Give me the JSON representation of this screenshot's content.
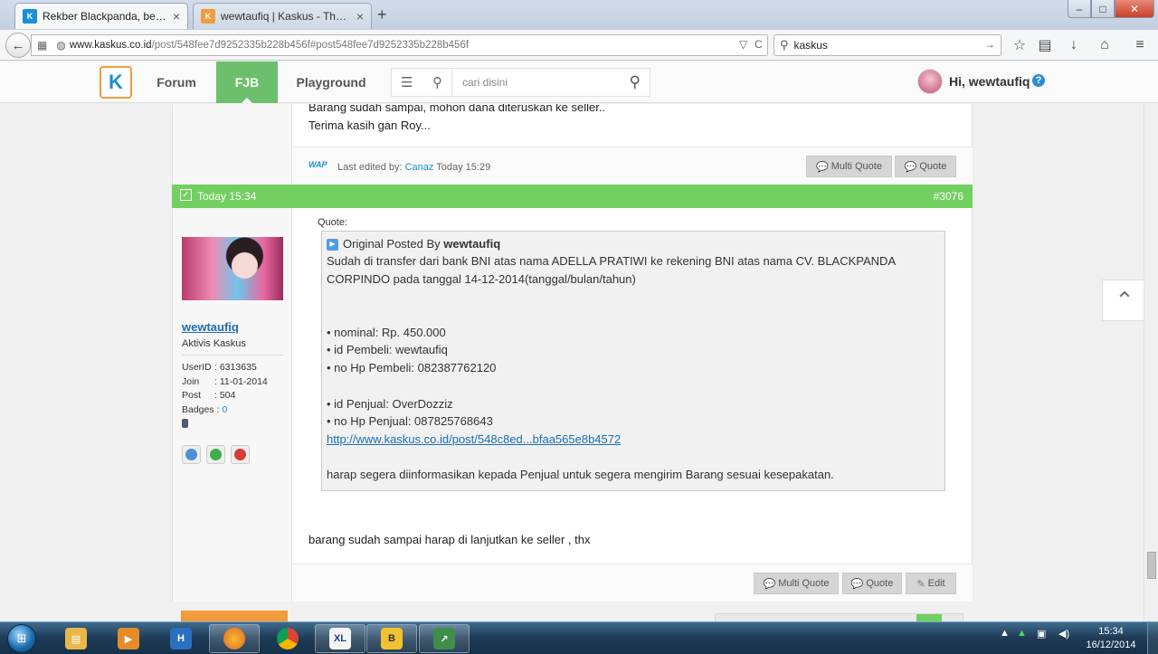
{
  "browser": {
    "tabs": [
      {
        "title": "Rekber Blackpanda, belanj...",
        "active": true
      },
      {
        "title": "wewtaufiq | Kaskus - The L...",
        "active": false
      }
    ],
    "url_host": "www.kaskus.co.id",
    "url_path": "/post/548fee7d9252335b228b456f#post548fee7d9252335b228b456f",
    "search_value": "kaskus",
    "window_controls": {
      "minimize": "–",
      "maximize": "□",
      "close": "✕"
    },
    "new_tab": "+"
  },
  "site": {
    "logo_glyph": "K",
    "nav": {
      "forum": "Forum",
      "fjb": "FJB",
      "playground": "Playground"
    },
    "search_placeholder": "cari disini",
    "greeting": "Hi, wewtaufiq",
    "help": "?"
  },
  "prev_post": {
    "lines": [
      "Barang sudah sampai, mohon dana diteruskan ke seller..",
      "Terima kasih gan Roy..."
    ],
    "edited_prefix": "Last edited by: ",
    "edited_user": "Canaz",
    "edited_time": " Today 15:29",
    "wap_label": "WAP",
    "buttons": {
      "multi_quote": "Multi Quote",
      "quote": "Quote"
    }
  },
  "post": {
    "date": "Today 15:34",
    "number": "#3076",
    "user": {
      "name": "wewtaufiq",
      "rank": "Aktivis Kaskus",
      "userid_label": "UserID",
      "userid": ": 6313635",
      "join_label": "Join",
      "join": ": 11-01-2014",
      "post_label": "Post",
      "post_count": ": 504",
      "badges_label": "Badges",
      "badges_sep": " : ",
      "badges": "0"
    },
    "quote_label": "Quote:",
    "quote": {
      "header_prefix": "Original Posted By ",
      "author": "wewtaufiq",
      "lines": [
        "Sudah di transfer dari bank BNI atas nama ADELLA PRATIWI ke rekening BNI atas nama CV. BLACKPANDA",
        "CORPINDO pada tanggal 14-12-2014(tanggal/bulan/tahun)",
        "",
        "",
        "• nominal: Rp. 450.000",
        "• id Pembeli: wewtaufiq",
        "• no Hp Pembeli: 082387762120",
        "",
        "• id Penjual: OverDozziz",
        "• no Hp Penjual: 087825768643"
      ],
      "link": "http://www.kaskus.co.id/post/548c8ed...bfaa565e8b4572",
      "after_link": "harap segera diinformasikan kepada Penjual untuk segera mengirim Barang sesuai kesepakatan."
    },
    "reply": "barang sudah sampai harap di lanjutkan ke seller , thx",
    "buttons": {
      "multi_quote": "Multi Quote",
      "quote": "Quote",
      "edit": "Edit"
    }
  },
  "taskbar": {
    "start_glyph": "⊞",
    "apps": [
      {
        "name": "file-explorer",
        "glyph": "▤",
        "color": "#e9b84a"
      },
      {
        "name": "media-player",
        "glyph": "▶",
        "color": "#e48b2a"
      },
      {
        "name": "h-app",
        "glyph": "H",
        "color": "#2b6fc2"
      },
      {
        "name": "firefox",
        "glyph": "●",
        "color": "#e66a1f"
      },
      {
        "name": "chrome",
        "glyph": "●",
        "color": "#3a9b45"
      },
      {
        "name": "xl",
        "glyph": "XL",
        "color": "#f4f4f4"
      },
      {
        "name": "game",
        "glyph": "B",
        "color": "#f1c232"
      },
      {
        "name": "chart-app",
        "glyph": "↗",
        "color": "#3f8f4a"
      }
    ],
    "time": "15:34",
    "date": "16/12/2014",
    "tray_arrow": "▲"
  },
  "colors": {
    "green": "#72d060",
    "orange": "#f39c3c",
    "link": "#1b6fb5"
  }
}
